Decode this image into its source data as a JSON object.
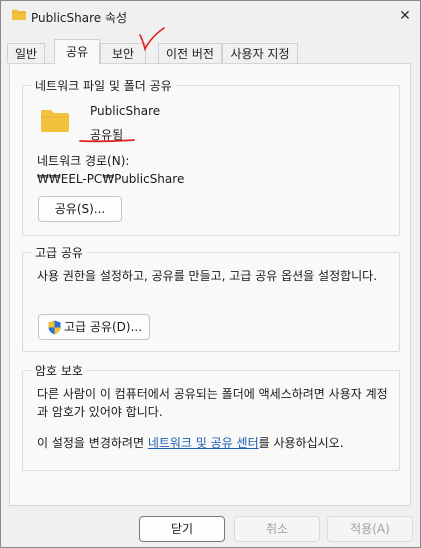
{
  "window": {
    "title": "PublicShare 속성",
    "close_glyph": "✕"
  },
  "tabs": [
    {
      "label": "일반"
    },
    {
      "label": "공유"
    },
    {
      "label": "보안"
    },
    {
      "label": "이전 버전"
    },
    {
      "label": "사용자 지정"
    }
  ],
  "network_sharing": {
    "title": "네트워크 파일 및 폴더 공유",
    "folder_name": "PublicShare",
    "status": "공유됨",
    "path_label": "네트워크 경로(N):",
    "path_value": "₩₩EEL-PC₩PublicShare",
    "share_button": "공유(S)..."
  },
  "advanced_sharing": {
    "title": "고급 공유",
    "description": "사용 권한을 설정하고, 공유를 만들고, 고급 공유 옵션을 설정합니다.",
    "button": "고급 공유(D)..."
  },
  "password_protection": {
    "title": "암호 보호",
    "description": "다른 사람이 이 컴퓨터에서 공유되는 폴더에 액세스하려면 사용자 계정과 암호가 있어야 합니다.",
    "change_prefix": "이 설정을 변경하려면 ",
    "change_link": "네트워크 및 공유 센터",
    "change_suffix": "를 사용하십시오."
  },
  "footer": {
    "ok": "닫기",
    "cancel": "취소",
    "apply": "적용(A)"
  },
  "colors": {
    "accent": "#1a5fb4",
    "annotation": "#e02020",
    "folder": "#f3c23c"
  }
}
